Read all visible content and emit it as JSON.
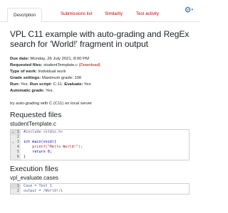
{
  "tabs": [
    {
      "label": "Description",
      "active": true
    },
    {
      "label": "Submissions list"
    },
    {
      "label": "Similarity"
    },
    {
      "label": "Test activity"
    }
  ],
  "gear": {
    "icon": "gear-icon",
    "caret": "▾"
  },
  "title": "VPL C11 example with auto-grading and RegEx search for 'World!' fragment in output",
  "details": {
    "due_label": "Due date:",
    "due_value": "Monday, 26 July 2021, 8:00 PM",
    "files_label": "Requested files:",
    "files_value": "studentTemplate.c",
    "download_label": "Download",
    "work_label": "Type of work:",
    "work_value": "Individual work",
    "grade_label": "Grade settings:",
    "grade_value": "Maximum grade: 100",
    "run_label": "Run:",
    "run_value": "Yes.",
    "script_label": "Run script:",
    "script_value": "C-11.",
    "evaluate_label": "Evaluate:",
    "evaluate_value": "Yes",
    "auto_label": "Automatic grade:",
    "auto_value": "Yes."
  },
  "note": "try auto-grading with C (C11) on local server",
  "requested_heading": "Requested files",
  "requested_filename": "studentTemplate.c",
  "template_code": [
    {
      "n": "1",
      "text": "#include <stdio.h>"
    },
    {
      "n": "2",
      "text": ""
    },
    {
      "n": "3",
      "text": "int main(void){"
    },
    {
      "n": "4",
      "text": "    printf(\"Hello World!\");"
    },
    {
      "n": "5",
      "text": "    return 0;"
    },
    {
      "n": "6",
      "text": "}"
    }
  ],
  "execution_heading": "Execution files",
  "execution_filename": "vpl_evaluate.cases",
  "cases_code": [
    {
      "n": "1",
      "text": "Case = Test 1"
    },
    {
      "n": "2",
      "text": "output = /World!/i"
    }
  ]
}
